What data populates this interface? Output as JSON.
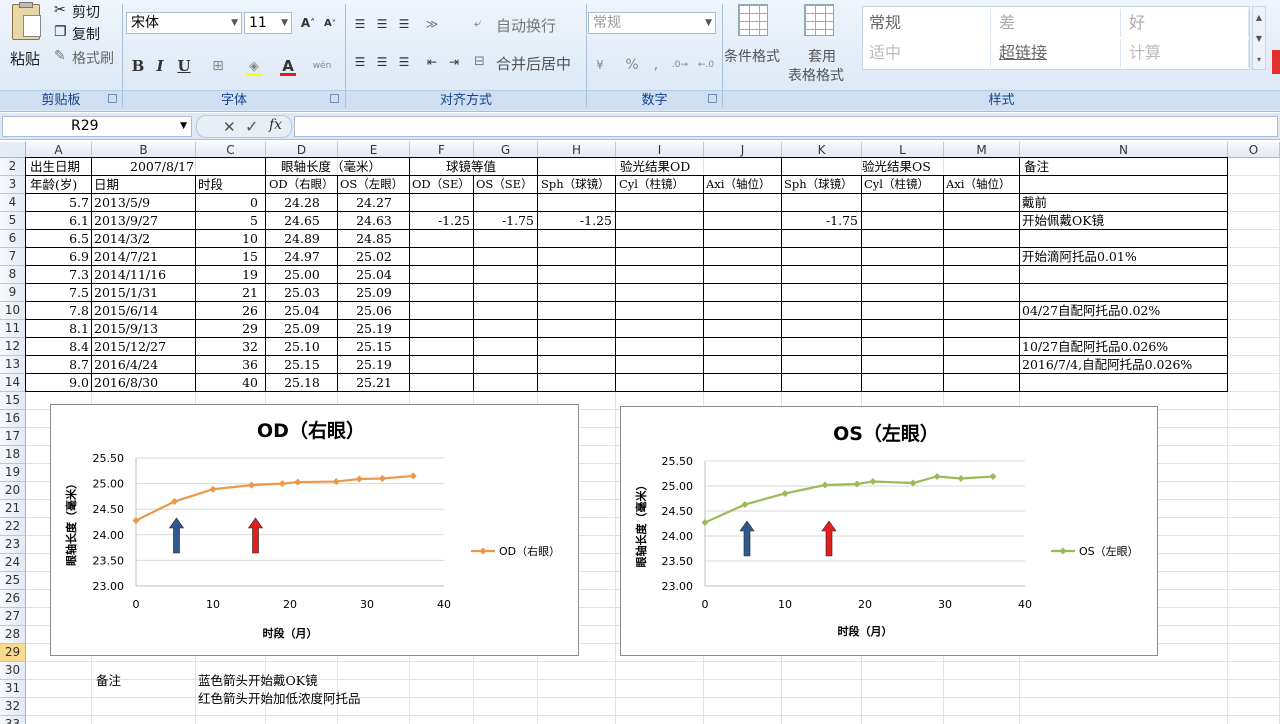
{
  "ribbon": {
    "clipboard": {
      "paste": "粘贴",
      "cut": "剪切",
      "copy": "复制",
      "format_painter": "格式刷",
      "group": "剪贴板"
    },
    "font": {
      "name": "宋体",
      "size": "11",
      "bold": "B",
      "italic": "I",
      "underline": "U",
      "font_color_glyph": "A",
      "phonetic": "wén",
      "group": "字体"
    },
    "alignment": {
      "wrap": "自动换行",
      "merge": "合并后居中",
      "group": "对齐方式"
    },
    "number": {
      "format": "常规",
      "percent": "%",
      "comma": ",",
      "group": "数字"
    },
    "styles": {
      "cond_format": "条件格式",
      "table_format_1": "套用",
      "table_format_2": "表格格式",
      "cells": [
        "常规",
        "差",
        "好",
        "适中",
        "超链接",
        "计算"
      ],
      "group": "样式"
    }
  },
  "formula_bar": {
    "name_box": "R29",
    "fx": "fx",
    "value": ""
  },
  "columns": [
    "A",
    "B",
    "C",
    "D",
    "E",
    "F",
    "G",
    "H",
    "I",
    "J",
    "K",
    "L",
    "M",
    "N",
    "O"
  ],
  "rows": [
    "2",
    "3",
    "4",
    "5",
    "6",
    "7",
    "8",
    "9",
    "10",
    "11",
    "12",
    "13",
    "14",
    "15",
    "16",
    "17",
    "18",
    "19",
    "20",
    "21",
    "22",
    "23",
    "24",
    "25",
    "26",
    "27",
    "28",
    "29",
    "30",
    "31",
    "32",
    "33"
  ],
  "sheet": {
    "r2": {
      "A": "出生日期",
      "B": "2007/8/17",
      "D": "眼轴长度（毫米）",
      "F": "球镜等值",
      "H": "验光结果OD",
      "L": "验光结果OS",
      "N": "备注"
    },
    "r3": [
      "年龄(岁)",
      "日期",
      "时段",
      "OD（右眼）",
      "OS（左眼）",
      "OD（SE）",
      "OS（SE）",
      "Sph（球镜）",
      "Cyl（柱镜）",
      "Axi（轴位）",
      "Sph（球镜）",
      "Cyl（柱镜）",
      "Axi（轴位）"
    ],
    "data": [
      {
        "age": "5.7",
        "date": "2013/5/9",
        "period": "0",
        "od": "24.28",
        "os": "24.27",
        "odse": "",
        "osse": "",
        "sph_od": "",
        "sph_os": "",
        "note": "戴前"
      },
      {
        "age": "6.1",
        "date": "2013/9/27",
        "period": "5",
        "od": "24.65",
        "os": "24.63",
        "odse": "-1.25",
        "osse": "-1.75",
        "sph_od": "-1.25",
        "sph_os": "-1.75",
        "note": "开始佩戴OK镜"
      },
      {
        "age": "6.5",
        "date": "2014/3/2",
        "period": "10",
        "od": "24.89",
        "os": "24.85",
        "odse": "",
        "osse": "",
        "sph_od": "",
        "sph_os": "",
        "note": ""
      },
      {
        "age": "6.9",
        "date": "2014/7/21",
        "period": "15",
        "od": "24.97",
        "os": "25.02",
        "odse": "",
        "osse": "",
        "sph_od": "",
        "sph_os": "",
        "note": "开始滴阿托品0.01%"
      },
      {
        "age": "7.3",
        "date": "2014/11/16",
        "period": "19",
        "od": "25.00",
        "os": "25.04",
        "odse": "",
        "osse": "",
        "sph_od": "",
        "sph_os": "",
        "note": ""
      },
      {
        "age": "7.5",
        "date": "2015/1/31",
        "period": "21",
        "od": "25.03",
        "os": "25.09",
        "odse": "",
        "osse": "",
        "sph_od": "",
        "sph_os": "",
        "note": ""
      },
      {
        "age": "7.8",
        "date": "2015/6/14",
        "period": "26",
        "od": "25.04",
        "os": "25.06",
        "odse": "",
        "osse": "",
        "sph_od": "",
        "sph_os": "",
        "note": "04/27自配阿托品0.02%"
      },
      {
        "age": "8.1",
        "date": "2015/9/13",
        "period": "29",
        "od": "25.09",
        "os": "25.19",
        "odse": "",
        "osse": "",
        "sph_od": "",
        "sph_os": "",
        "note": ""
      },
      {
        "age": "8.4",
        "date": "2015/12/27",
        "period": "32",
        "od": "25.10",
        "os": "25.15",
        "odse": "",
        "osse": "",
        "sph_od": "",
        "sph_os": "",
        "note": "10/27自配阿托品0.026%"
      },
      {
        "age": "8.7",
        "date": "2016/4/24",
        "period": "36",
        "od": "25.15",
        "os": "25.19",
        "odse": "",
        "osse": "",
        "sph_od": "",
        "sph_os": "",
        "note": "2016/7/4,自配阿托品0.026%"
      },
      {
        "age": "9.0",
        "date": "2016/8/30",
        "period": "40",
        "od": "25.18",
        "os": "25.21",
        "odse": "",
        "osse": "",
        "sph_od": "",
        "sph_os": "",
        "note": ""
      }
    ],
    "remarks": {
      "label": "备注",
      "line1": "蓝色箭头开始戴OK镜",
      "line2": "红色箭头开始加低浓度阿托品"
    }
  },
  "chart_data": [
    {
      "type": "line",
      "title": "OD（右眼）",
      "xlabel": "时段（月）",
      "ylabel": "眼轴长度（毫米）",
      "xlim": [
        0,
        40
      ],
      "ylim": [
        23.0,
        25.5
      ],
      "xticks": [
        "0",
        "10",
        "20",
        "30",
        "40"
      ],
      "yticks": [
        "23.00",
        "23.50",
        "24.00",
        "24.50",
        "25.00",
        "25.50"
      ],
      "color": "#e8994c",
      "legend": "right",
      "series": [
        {
          "name": "OD（右眼）",
          "x": [
            0,
            5,
            10,
            15,
            19,
            21,
            26,
            29,
            32,
            36
          ],
          "y": [
            24.28,
            24.65,
            24.89,
            24.97,
            25.0,
            25.03,
            25.04,
            25.09,
            25.1,
            25.15
          ]
        }
      ],
      "annotations": [
        {
          "type": "arrow",
          "color": "#2e5a8f",
          "x": 5
        },
        {
          "type": "arrow",
          "color": "#e02020",
          "x": 15
        }
      ]
    },
    {
      "type": "line",
      "title": "OS（左眼）",
      "xlabel": "时段（月）",
      "ylabel": "眼轴长度（毫米）",
      "xlim": [
        0,
        40
      ],
      "ylim": [
        23.0,
        25.5
      ],
      "xticks": [
        "0",
        "10",
        "20",
        "30",
        "40"
      ],
      "yticks": [
        "23.00",
        "23.50",
        "24.00",
        "24.50",
        "25.00",
        "25.50"
      ],
      "color": "#9bbb59",
      "legend": "right",
      "series": [
        {
          "name": "OS（左眼）",
          "x": [
            0,
            5,
            10,
            15,
            19,
            21,
            26,
            29,
            32,
            36
          ],
          "y": [
            24.27,
            24.63,
            24.85,
            25.02,
            25.04,
            25.09,
            25.06,
            25.19,
            25.15,
            25.19
          ]
        }
      ],
      "annotations": [
        {
          "type": "arrow",
          "color": "#2e5a8f",
          "x": 5
        },
        {
          "type": "arrow",
          "color": "#e02020",
          "x": 15
        }
      ]
    }
  ]
}
